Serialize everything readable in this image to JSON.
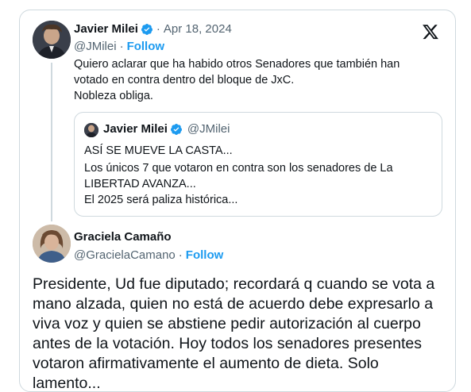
{
  "parent_tweet": {
    "author_name": "Javier Milei",
    "date": "Apr 18, 2024",
    "handle": "@JMilei",
    "follow_label": "Follow",
    "lines": [
      "Quiero aclarar que ha habido otros Senadores que también han",
      "votado en contra dentro del bloque de JxC.",
      "Nobleza obliga."
    ],
    "quote": {
      "author_name": "Javier Milei",
      "handle": "@JMilei",
      "lines": [
        "ASÍ SE MUEVE LA CASTA...",
        "Los únicos 7 que votaron en contra son los senadores de La",
        "LIBERTAD AVANZA...",
        "El 2025 será paliza histórica..."
      ]
    }
  },
  "reply_tweet": {
    "author_name": "Graciela Camaño",
    "handle": "@GracielaCamano",
    "follow_label": "Follow",
    "lines": [
      "Presidente, Ud fue diputado; recordará q cuando se vota a",
      "mano alzada, quien no está de acuerdo debe expresarlo a",
      "viva voz y quien se abstiene pedir autorización al cuerpo",
      "antes de la votación. Hoy todos los senadores presentes",
      "votaron afirmativamente el aumento de dieta. Solo",
      "lamento..."
    ]
  },
  "colors": {
    "accent": "#1d9bf0",
    "text": "#0f1419",
    "secondary": "#536471",
    "border": "#cfd9de"
  },
  "icons": [
    "verified-badge-icon",
    "x-logo-icon"
  ]
}
